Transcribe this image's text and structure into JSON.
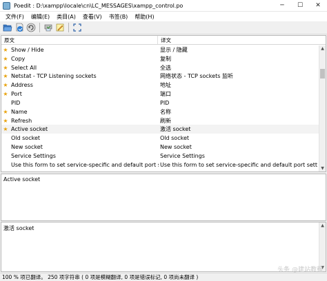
{
  "window": {
    "title": "Poedit : D:\\xampp\\locale\\cn\\LC_MESSAGES\\xampp_control.po",
    "minimize": "─",
    "maximize": "☐",
    "close": "✕"
  },
  "menu": [
    "文件(F)",
    "编辑(E)",
    "类目(A)",
    "查看(V)",
    "书签(B)",
    "帮助(H)"
  ],
  "toolbar": {
    "icons": [
      "open-folder-icon",
      "save-icon",
      "update-catalog-icon",
      "validate-icon",
      "edit-comment-icon",
      "fullscreen-icon"
    ]
  },
  "list": {
    "header_source": "原文",
    "header_translation": "译文",
    "rows": [
      {
        "source": "Show / Hide",
        "translation": "显示 / 隐藏",
        "star": true
      },
      {
        "source": "Copy",
        "translation": "复制",
        "star": true
      },
      {
        "source": "Select All",
        "translation": "全选",
        "star": true
      },
      {
        "source": "Netstat - TCP Listening sockets",
        "translation": "网络状态 - TCP sockets 监听",
        "star": true
      },
      {
        "source": "Address",
        "translation": "地址",
        "star": true
      },
      {
        "source": "Port",
        "translation": "端口",
        "star": true
      },
      {
        "source": "PID",
        "translation": "PID",
        "star": false
      },
      {
        "source": "Name",
        "translation": "名称",
        "star": true
      },
      {
        "source": "Refresh",
        "translation": "刷新",
        "star": true
      },
      {
        "source": "Active socket",
        "translation": "激活 socket",
        "star": true,
        "selected": true
      },
      {
        "source": "Old socket",
        "translation": "Old socket",
        "star": false
      },
      {
        "source": "New socket",
        "translation": "New socket",
        "star": false
      },
      {
        "source": "Service Settings",
        "translation": "Service Settings",
        "star": false
      },
      {
        "source": "Use this form to set service-specific and default port setting...",
        "translation": "Use this form to set service-specific and default port settings...",
        "star": false
      }
    ]
  },
  "source_pane": {
    "text": "Active socket"
  },
  "translation_pane": {
    "text": "激活 socket"
  },
  "status": {
    "text": "100 % 项已翻译。 250 项字符串 ( 0 项是模糊翻译, 0 项是错误标记, 0 项尚未翻译 )"
  },
  "watermark": "头条 @建站教程"
}
